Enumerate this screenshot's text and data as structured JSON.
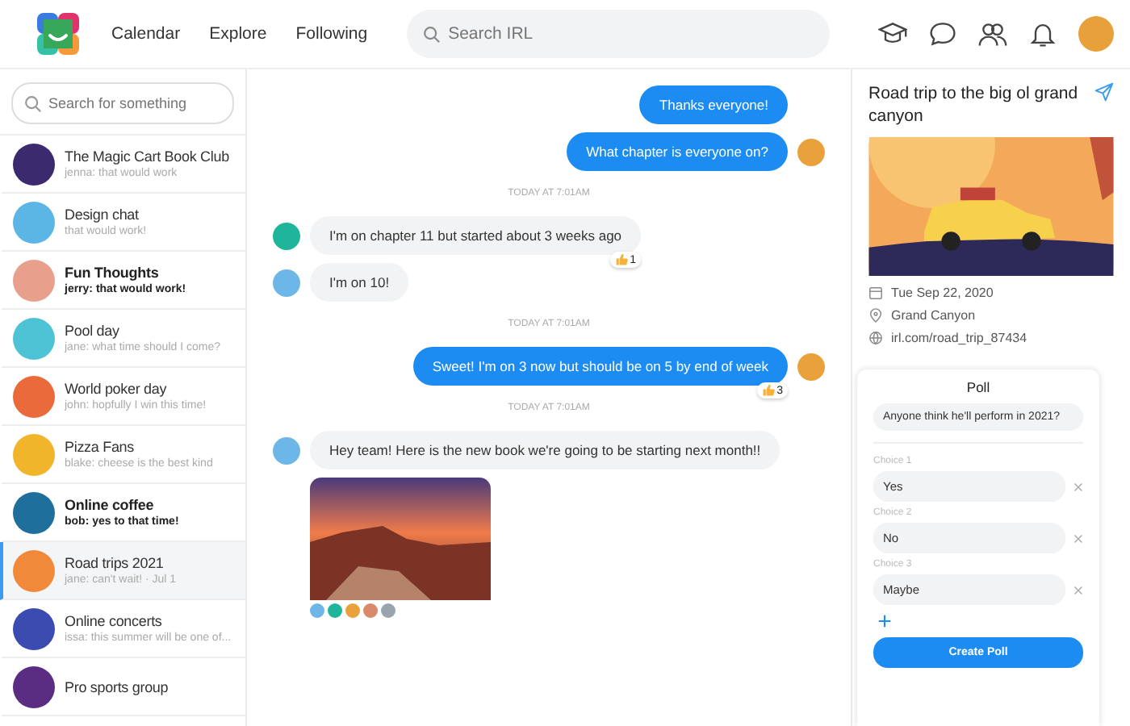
{
  "nav": {
    "links": [
      "Calendar",
      "Explore",
      "Following"
    ],
    "search_placeholder": "Search IRL"
  },
  "sidebar": {
    "search_placeholder": "Search for something",
    "conversations": [
      {
        "name": "The Magic Cart Book Club",
        "preview": "jenna: that would work",
        "unread": false,
        "selected": false
      },
      {
        "name": "Design chat",
        "preview": "that would work!",
        "unread": false,
        "selected": false
      },
      {
        "name": "Fun Thoughts",
        "preview": "jerry: that would work!",
        "unread": true,
        "selected": false
      },
      {
        "name": "Pool day",
        "preview": "jane: what time should I come?",
        "unread": false,
        "selected": false
      },
      {
        "name": "World poker day",
        "preview": "john: hopfully I win this time!",
        "unread": false,
        "selected": false
      },
      {
        "name": "Pizza Fans",
        "preview": "blake: cheese is the best kind",
        "unread": false,
        "selected": false
      },
      {
        "name": "Online coffee",
        "preview": "bob: yes to that time!",
        "unread": true,
        "selected": false
      },
      {
        "name": "Road trips 2021",
        "preview": "jane: can't wait!  · Jul 1",
        "unread": false,
        "selected": true
      },
      {
        "name": "Online concerts",
        "preview": "issa: this summer will be one of...",
        "unread": false,
        "selected": false
      },
      {
        "name": "Pro sports group",
        "unread": false,
        "selected": false
      }
    ]
  },
  "messages": [
    {
      "kind": "outgoing",
      "text": "Thanks everyone!"
    },
    {
      "kind": "outgoing",
      "text": "What chapter is everyone on?",
      "avatar": true
    },
    {
      "kind": "timestamp",
      "text": "TODAY AT 7:01AM"
    },
    {
      "kind": "incoming",
      "text": "I'm on chapter 11 but started about 3 weeks ago",
      "avatar": true,
      "reaction": "1"
    },
    {
      "kind": "incoming",
      "text": "I'm on 10!",
      "avatar": true
    },
    {
      "kind": "timestamp",
      "text": "TODAY AT 7:01AM"
    },
    {
      "kind": "outgoing",
      "text": "Sweet! I'm on 3 now but should be on 5 by end of week",
      "avatar": true,
      "reaction": "3"
    },
    {
      "kind": "timestamp",
      "text": "TODAY AT 7:01AM"
    },
    {
      "kind": "incoming",
      "text": "Hey team! Here is the new book we're going to be starting next month!!",
      "avatar": true
    },
    {
      "kind": "image"
    }
  ],
  "event": {
    "title": "Road trip to the big ol grand canyon",
    "date": "Tue Sep 22, 2020",
    "location": "Grand Canyon",
    "link": "irl.com/road_trip_87434"
  },
  "poll": {
    "title": "Poll",
    "question": "Anyone think he'll perform in 2021?",
    "choices": [
      {
        "label": "Choice 1",
        "value": "Yes"
      },
      {
        "label": "Choice 2",
        "value": "No"
      },
      {
        "label": "Choice 3",
        "value": "Maybe"
      }
    ],
    "add": "+",
    "submit": "Create Poll"
  }
}
